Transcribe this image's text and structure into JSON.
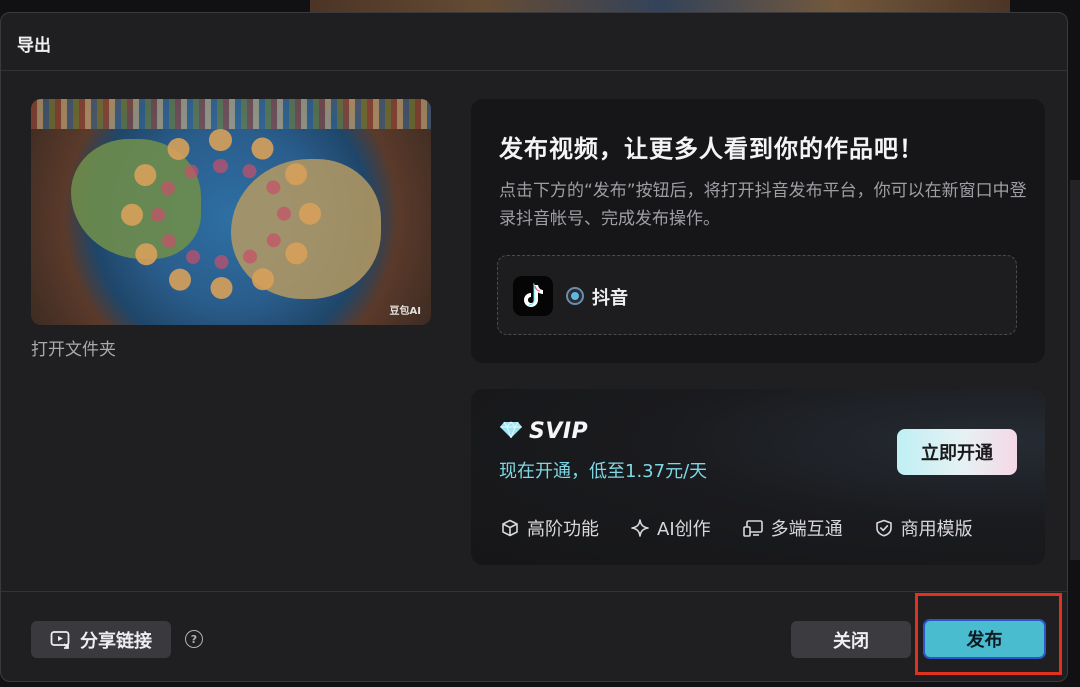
{
  "dialog": {
    "title": "导出"
  },
  "preview": {
    "watermark": "豆包AI",
    "open_folder_label": "打开文件夹"
  },
  "publish": {
    "heading": "发布视频，让更多人看到你的作品吧！",
    "description": "点击下方的“发布”按钮后，将打开抖音发布平台，你可以在新窗口中登录抖音帐号、完成发布操作。",
    "platform": {
      "name": "抖音",
      "selected": true,
      "icon": "tiktok-logo-icon"
    }
  },
  "svip": {
    "title": "SVIP",
    "promo": "现在开通，低至1.37元/天",
    "cta_label": "立即开通",
    "features": [
      {
        "label": "高阶功能",
        "icon": "cube-icon"
      },
      {
        "label": "AI创作",
        "icon": "sparkle-icon"
      },
      {
        "label": "多端互通",
        "icon": "devices-icon"
      },
      {
        "label": "商用模版",
        "icon": "shield-check-icon"
      }
    ]
  },
  "footer": {
    "share_label": "分享链接",
    "help_icon": "help-circle-icon",
    "close_label": "关闭",
    "publish_label": "发布"
  },
  "colors": {
    "accent": "#49bcd0",
    "promo": "#7fd7e6",
    "highlight": "#e0321f"
  }
}
